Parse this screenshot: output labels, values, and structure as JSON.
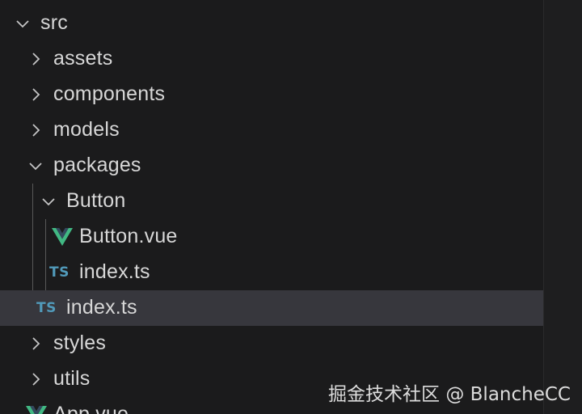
{
  "explorer": {
    "items": [
      {
        "label": "src",
        "type": "folder",
        "expanded": true,
        "depth": 0
      },
      {
        "label": "assets",
        "type": "folder",
        "expanded": false,
        "depth": 1
      },
      {
        "label": "components",
        "type": "folder",
        "expanded": false,
        "depth": 1
      },
      {
        "label": "models",
        "type": "folder",
        "expanded": false,
        "depth": 1
      },
      {
        "label": "packages",
        "type": "folder",
        "expanded": true,
        "depth": 1
      },
      {
        "label": "Button",
        "type": "folder",
        "expanded": true,
        "depth": 2
      },
      {
        "label": "Button.vue",
        "type": "vue-file",
        "icon": "vue-icon",
        "depth": 3
      },
      {
        "label": "index.ts",
        "type": "ts-file",
        "icon": "ts-icon",
        "icon_text": "TS",
        "depth": 3
      },
      {
        "label": "index.ts",
        "type": "ts-file",
        "icon": "ts-icon",
        "icon_text": "TS",
        "depth": 2,
        "selected": true
      },
      {
        "label": "styles",
        "type": "folder",
        "expanded": false,
        "depth": 1
      },
      {
        "label": "utils",
        "type": "folder",
        "expanded": false,
        "depth": 1
      },
      {
        "label": "App.vue",
        "type": "vue-file",
        "icon": "vue-icon",
        "depth": 1
      }
    ]
  },
  "colors": {
    "background": "#1b1b1c",
    "selected_row": "#37373d",
    "text": "#d7d7d7",
    "ts_icon": "#519aba",
    "vue_green": "#41b883",
    "vue_dark": "#34495e"
  },
  "watermark": "掘金技术社区 @ BlancheCC"
}
